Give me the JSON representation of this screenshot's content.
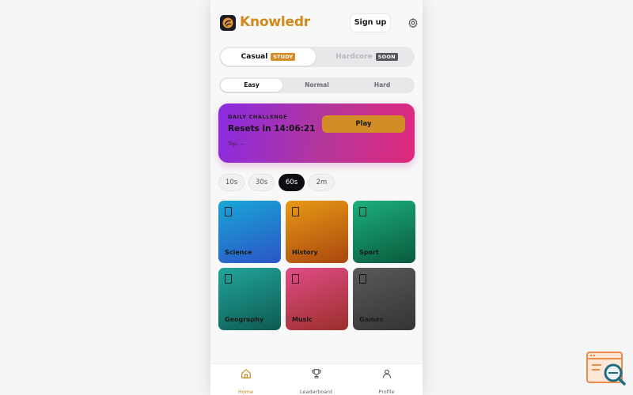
{
  "header": {
    "brand": "Knowledr",
    "signup_label": "Sign up",
    "logo_icon": "brain-logo-icon",
    "settings_icon": "gear-icon"
  },
  "modes": [
    {
      "label": "Casual",
      "badge": "STUDY",
      "active": true
    },
    {
      "label": "Hardcore",
      "badge": "SOON",
      "active": false
    }
  ],
  "difficulty": [
    {
      "label": "Easy",
      "active": true
    },
    {
      "label": "Normal",
      "active": false
    },
    {
      "label": "Hard",
      "active": false
    }
  ],
  "daily": {
    "label": "DAILY CHALLENGE",
    "reset_text": "Resets in 14:06:21",
    "top_text": "Top: —",
    "play_label": "Play"
  },
  "durations": [
    {
      "label": "10s",
      "active": false
    },
    {
      "label": "30s",
      "active": false
    },
    {
      "label": "60s",
      "active": true
    },
    {
      "label": "2m",
      "active": false
    }
  ],
  "categories": [
    {
      "label": "Science",
      "color_from": "#18a6d6",
      "color_to": "#2c55c6"
    },
    {
      "label": "History",
      "color_from": "#e79a16",
      "color_to": "#a9470e"
    },
    {
      "label": "Sport",
      "color_from": "#1bb07c",
      "color_to": "#0a5a3c"
    },
    {
      "label": "Geography",
      "color_from": "#21a59a",
      "color_to": "#0e5a52"
    },
    {
      "label": "Music",
      "color_from": "#e14c86",
      "color_to": "#9a2f2a"
    },
    {
      "label": "Games",
      "color_from": "#5a5a5d",
      "color_to": "#343436"
    }
  ],
  "nav": [
    {
      "label": "Home",
      "icon": "home-icon",
      "active": true
    },
    {
      "label": "Leaderboard",
      "icon": "trophy-icon",
      "active": false
    },
    {
      "label": "Profile",
      "icon": "user-icon",
      "active": false
    }
  ],
  "colors": {
    "accent": "#d08a1c",
    "active_chip": "#0e0e12",
    "daily_gradient_from": "#8a2be2",
    "daily_gradient_to": "#e0287c"
  }
}
